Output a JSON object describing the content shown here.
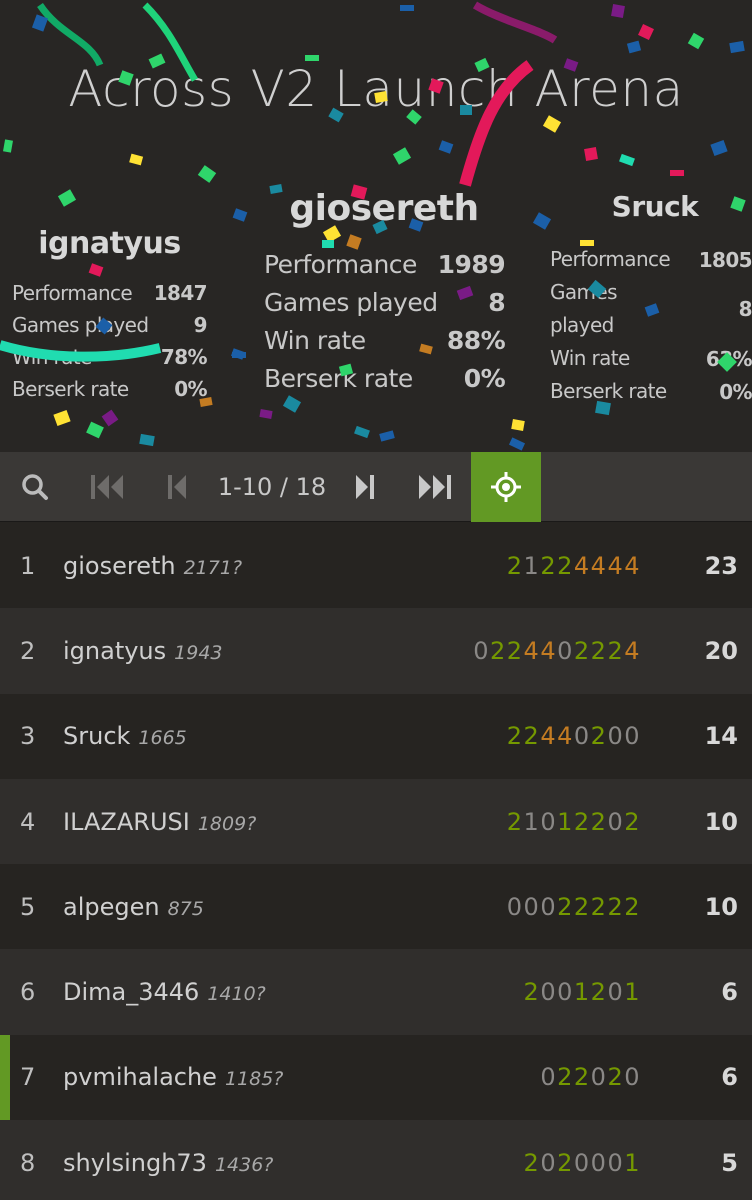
{
  "arena": {
    "title": "Across V2 Launch Arena"
  },
  "podium": [
    {
      "place": 1,
      "name": "giosereth",
      "stats": [
        {
          "label": "Performance",
          "value": "1989"
        },
        {
          "label": "Games played",
          "value": "8"
        },
        {
          "label": "Win rate",
          "value": "88%"
        },
        {
          "label": "Berserk rate",
          "value": "0%"
        }
      ]
    },
    {
      "place": 2,
      "name": "ignatyus",
      "stats": [
        {
          "label": "Performance",
          "value": "1847"
        },
        {
          "label": "Games played",
          "value": "9"
        },
        {
          "label": "Win rate",
          "value": "78%"
        },
        {
          "label": "Berserk rate",
          "value": "0%"
        }
      ]
    },
    {
      "place": 3,
      "name": "Sruck",
      "stats": [
        {
          "label": "Performance",
          "value": "1805"
        },
        {
          "label": "Games played",
          "value": "8"
        },
        {
          "label": "Win rate",
          "value": "63%"
        },
        {
          "label": "Berserk rate",
          "value": "0%"
        }
      ]
    }
  ],
  "pager": {
    "range": "1-10 / 18",
    "icons": {
      "search": "search-icon",
      "first": "first-page-icon",
      "prev": "previous-page-icon",
      "next": "next-page-icon",
      "last": "last-page-icon",
      "me": "crosshair-icon"
    },
    "me_color": "#629924"
  },
  "standings": [
    {
      "rank": "1",
      "name": "giosereth",
      "rating": "2171?",
      "sheet": "21224444",
      "score": "23"
    },
    {
      "rank": "2",
      "name": "ignatyus",
      "rating": "1943",
      "sheet": "0224402224",
      "score": "20"
    },
    {
      "rank": "3",
      "name": "Sruck",
      "rating": "1665",
      "sheet": "22440200",
      "score": "14"
    },
    {
      "rank": "4",
      "name": "ILAZARUSI",
      "rating": "1809?",
      "sheet": "21012202",
      "score": "10"
    },
    {
      "rank": "5",
      "name": "alpegen",
      "rating": "875",
      "sheet": "00022222",
      "score": "10"
    },
    {
      "rank": "6",
      "name": "Dima_3446",
      "rating": "1410?",
      "sheet": "2001201",
      "score": "6"
    },
    {
      "rank": "7",
      "name": "pvmihalache",
      "rating": "1185?",
      "sheet": "022020",
      "score": "6",
      "me": true
    },
    {
      "rank": "8",
      "name": "shylsingh73",
      "rating": "1436?",
      "sheet": "2020001",
      "score": "5"
    }
  ],
  "colors": {
    "win": "#759900",
    "streak": "#c47c22",
    "neutral": "#8a8886",
    "background": "#262421"
  }
}
